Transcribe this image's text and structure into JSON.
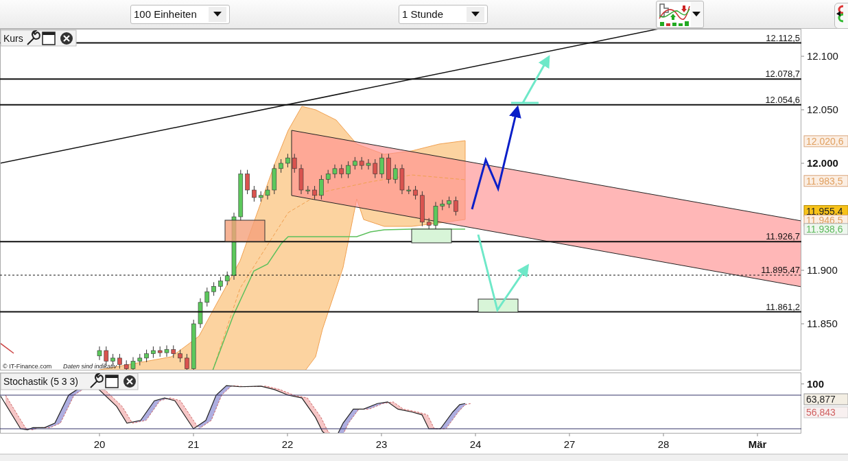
{
  "toolbar": {
    "units": {
      "value": "100 Einheiten"
    },
    "interval": {
      "value": "1 Stunde"
    }
  },
  "price_panel": {
    "title": "Kurs",
    "y_ticks": [
      {
        "label": "12.100",
        "bold": false
      },
      {
        "label": "12.050",
        "bold": false
      },
      {
        "label": "12.000",
        "bold": true
      },
      {
        "label": "11.900",
        "bold": false
      },
      {
        "label": "11.850",
        "bold": false
      }
    ],
    "levels": [
      {
        "label": "12.112,5",
        "kind": "level"
      },
      {
        "label": "12.078,7",
        "kind": "level"
      },
      {
        "label": "12.054,6",
        "kind": "level"
      },
      {
        "label": "11.926,7",
        "kind": "level"
      },
      {
        "label": "11.895,47",
        "kind": "reference"
      },
      {
        "label": "11.861,2",
        "kind": "level"
      }
    ],
    "badges": [
      {
        "label": "12.020,6",
        "kind": "band"
      },
      {
        "label": "11.983,5",
        "kind": "band"
      },
      {
        "label": "11.955,4",
        "kind": "last"
      },
      {
        "label": "11.946,5",
        "kind": "band"
      },
      {
        "label": "11.938,6",
        "kind": "average"
      }
    ],
    "credit": "© IT-Finance.com",
    "disclaimer": "Daten sind indikativ"
  },
  "stochastic_panel": {
    "title": "Stochastik (5 3 3)",
    "y_ticks": [
      {
        "label": "100",
        "bold": true
      }
    ],
    "badges": [
      {
        "label": "63,877",
        "kind": "main"
      },
      {
        "label": "56,843",
        "kind": "signal"
      }
    ]
  },
  "x_axis": [
    {
      "label": "20",
      "bold": false
    },
    {
      "label": "21",
      "bold": false
    },
    {
      "label": "22",
      "bold": false
    },
    {
      "label": "23",
      "bold": false
    },
    {
      "label": "24",
      "bold": false
    },
    {
      "label": "27",
      "bold": false
    },
    {
      "label": "28",
      "bold": false
    },
    {
      "label": "Mär",
      "bold": true
    }
  ]
}
